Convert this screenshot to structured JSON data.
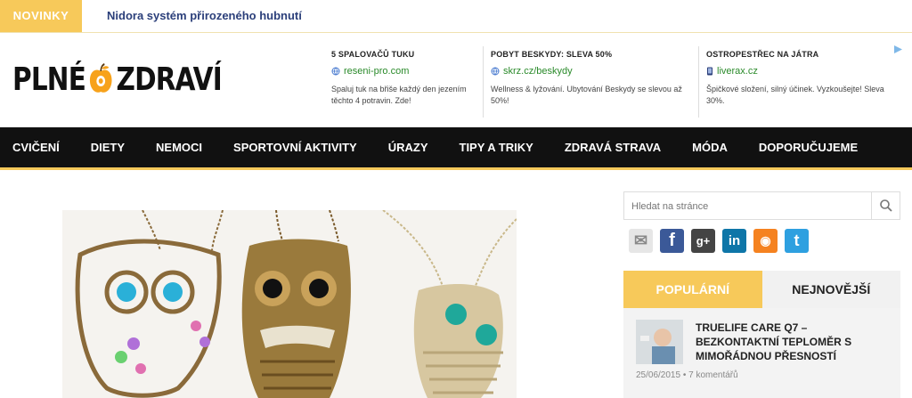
{
  "topbar": {
    "badge": "NOVINKY",
    "ticker": "Nidora systém přirozeného hubnutí"
  },
  "logo": {
    "left": "PLNÉ",
    "right": "ZDRAVÍ"
  },
  "ads": [
    {
      "title": "5 SPALOVAČŮ TUKU",
      "url": "reseni-pro.com",
      "desc": "Spaluj tuk na břiše každý den jezením těchto 4 potravin. Zde!",
      "icon": "globe-icon"
    },
    {
      "title": "POBYT BESKYDY: SLEVA 50%",
      "url": "skrz.cz/beskydy",
      "desc": "Wellness & lyžování. Ubytování Beskydy se slevou až 50%!",
      "icon": "globe-icon"
    },
    {
      "title": "OSTROPESTŘEC NA JÁTRA",
      "url": "liverax.cz",
      "desc": "Špičkové složení, silný účinek. Vyzkoušejte! Sleva 30%.",
      "icon": "phone-icon"
    }
  ],
  "nav": [
    "CVIČENÍ",
    "DIETY",
    "NEMOCI",
    "SPORTOVNÍ AKTIVITY",
    "ÚRAZY",
    "TIPY A TRIKY",
    "ZDRAVÁ STRAVA",
    "MÓDA",
    "DOPORUČUJEME"
  ],
  "search": {
    "placeholder": "Hledat na stránce"
  },
  "social": [
    {
      "name": "email-icon",
      "glyph": "✉",
      "color": "#e6e6e6"
    },
    {
      "name": "facebook-icon",
      "glyph": "f",
      "color": "#3b5998"
    },
    {
      "name": "google-plus-icon",
      "glyph": "g+",
      "color": "#444444"
    },
    {
      "name": "linkedin-icon",
      "glyph": "in",
      "color": "#0e76a8"
    },
    {
      "name": "rss-icon",
      "glyph": "◉",
      "color": "#f58220"
    },
    {
      "name": "twitter-icon",
      "glyph": "t",
      "color": "#2ea0e0"
    }
  ],
  "tabs": {
    "popular": "POPULÁRNÍ",
    "latest": "NEJNOVĚJŠÍ"
  },
  "post": {
    "title": "TRUELIFE CARE Q7 – BEZKONTAKTNÍ TEPLOMĚR S MIMOŘÁDNOU PŘESNOSTÍ",
    "meta": "25/06/2015 • 7 komentářů"
  },
  "colors": {
    "accent": "#f7c95a",
    "nav_bg": "#111111",
    "link": "#2b3f7a"
  }
}
